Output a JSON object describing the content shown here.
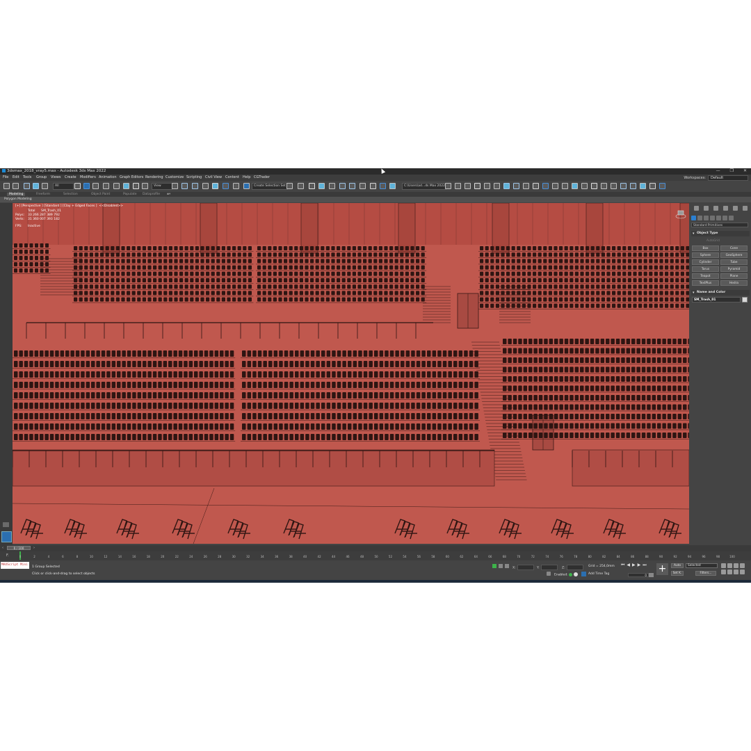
{
  "window": {
    "title": "3dsmax_2018_vray5.max - Autodesk 3ds Max 2022",
    "controls": [
      "—",
      "❐",
      "✕"
    ]
  },
  "menu": [
    "File",
    "Edit",
    "Tools",
    "Group",
    "Views",
    "Create",
    "Modifiers",
    "Animation",
    "Graph Editors",
    "Rendering",
    "Customize",
    "Scripting",
    "Civil View",
    "Content",
    "Help",
    "CGTrader"
  ],
  "workspaces": {
    "label": "Workspaces:",
    "value": "Default"
  },
  "toolbar": {
    "selection_filter": "All",
    "ref_coord": "View",
    "named_selection": "Create Selection Set",
    "project_path": "C:\\Users\\ad...ds Max 2022"
  },
  "ribbon": {
    "tabs": [
      "Modeling",
      "Freeform",
      "Selection",
      "Object Paint",
      "Populate",
      "Dataprofile"
    ],
    "active_tab": "Modeling",
    "sub_label": "Polygon Modeling"
  },
  "viewport": {
    "label": "[+] [Perspective ] [Standard ] [Clay + Edged Faces ]",
    "label_extra": "<<Disabled>>",
    "stats": {
      "header": "Total",
      "object": "SM_Trash_01",
      "polys_label": "Polys:",
      "polys_value": "33 266 287   389 792",
      "verts_label": "Verts:",
      "verts_value": "31 360 007   393 182",
      "fps_label": "FPS:",
      "fps_value": "Inactive"
    },
    "colors": {
      "floor": "#c0584e",
      "wall": "#b54c43",
      "seat": "#2e1512",
      "wire": "#3a1a16"
    }
  },
  "command_panel": {
    "category": "Standard Primitives",
    "object_type_title": "Object Type",
    "autogrid": "AutoGrid",
    "primitives": [
      "Box",
      "Cone",
      "Sphere",
      "GeoSphere",
      "Cylinder",
      "Tube",
      "Torus",
      "Pyramid",
      "Teapot",
      "Plane",
      "TextPlus",
      "Hedra"
    ],
    "name_color_title": "Name and Color",
    "object_name": "SM_Trash_01"
  },
  "timeline": {
    "position": "0 / 100",
    "ticks": [
      "0",
      "2",
      "4",
      "6",
      "8",
      "10",
      "12",
      "14",
      "16",
      "18",
      "20",
      "22",
      "24",
      "26",
      "28",
      "30",
      "32",
      "34",
      "36",
      "38",
      "40",
      "42",
      "44",
      "46",
      "48",
      "50",
      "52",
      "54",
      "56",
      "58",
      "60",
      "62",
      "64",
      "66",
      "68",
      "70",
      "72",
      "74",
      "76",
      "78",
      "80",
      "82",
      "84",
      "86",
      "88",
      "90",
      "92",
      "94",
      "96",
      "98",
      "100"
    ]
  },
  "status": {
    "maxscript": "MAXScript Mini",
    "line1": "1 Group Selected",
    "line2": "Click or click-and-drag to select objects",
    "x_label": "X:",
    "y_label": "Y:",
    "z_label": "Z:",
    "grid": "Grid = 254,0mm",
    "enabled": "Enabled:",
    "add_time_tag": "Add Time Tag",
    "auto": "Auto",
    "set_key": "Set K.",
    "selected": "Selected",
    "filters": "Filters...",
    "frame": "0"
  }
}
